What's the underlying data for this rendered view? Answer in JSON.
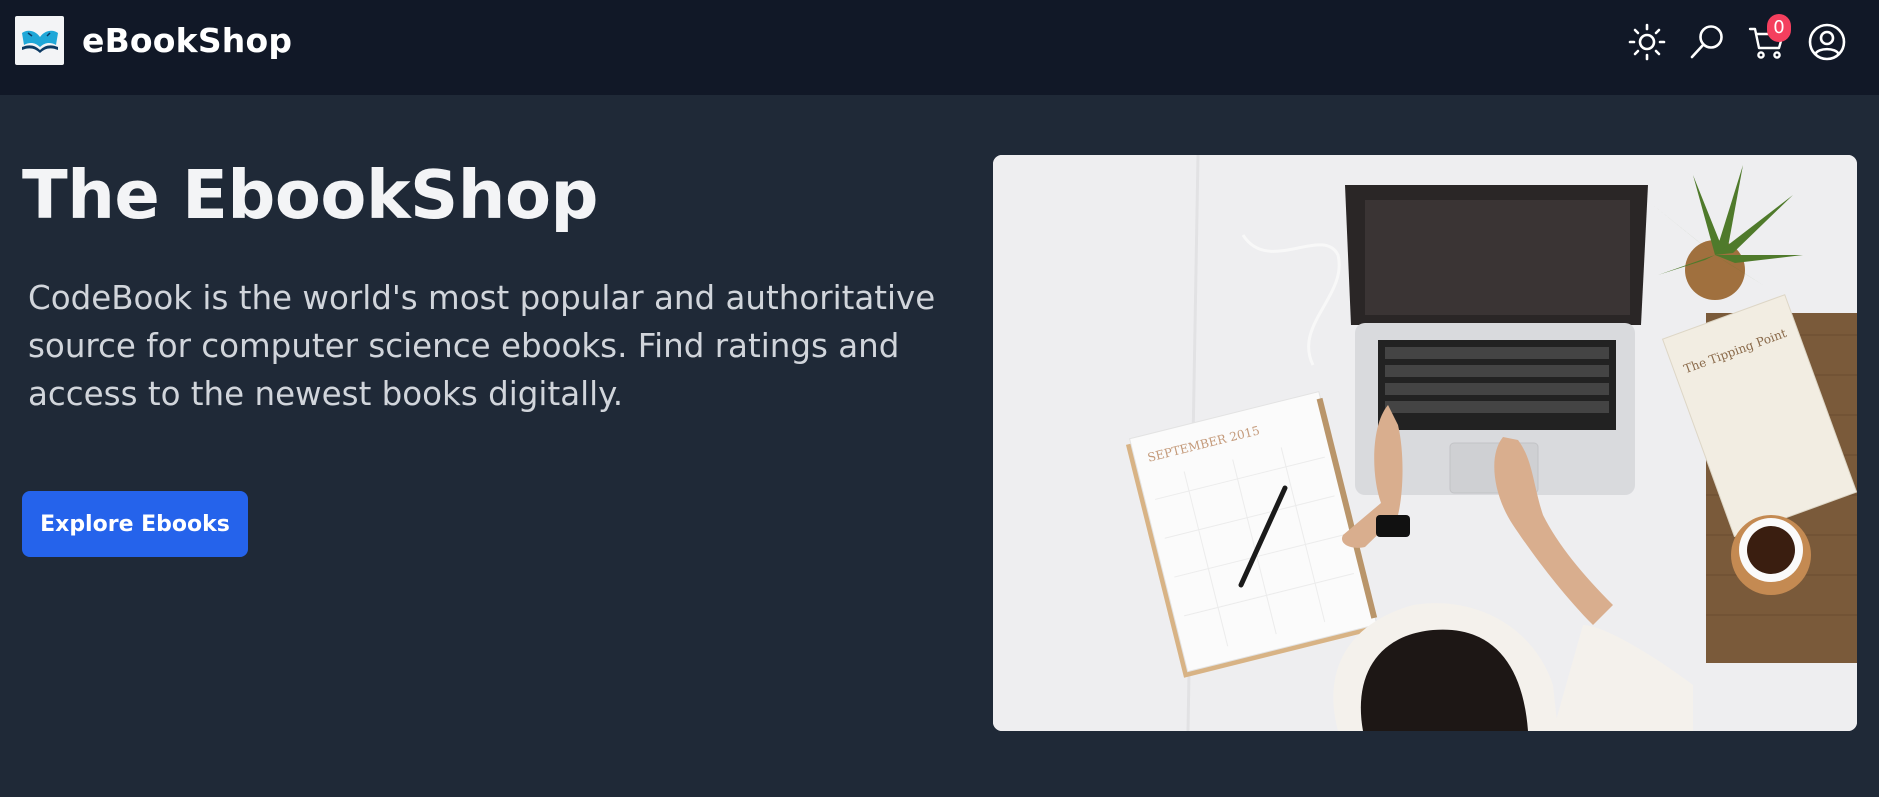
{
  "header": {
    "brand_name": "eBookShop",
    "icons": [
      "open-book-logo",
      "sun-icon",
      "search-icon",
      "cart-icon",
      "user-account-icon"
    ],
    "cart_count": "0"
  },
  "hero": {
    "title": "The EbookShop",
    "description": "CodeBook is the world's most popular and authoritative source for computer science ebooks. Find ratings and access to the newest books digitally.",
    "cta_label": "Explore Ebooks",
    "image_notebook_text": "SEPTEMBER 2015",
    "image_book_title": "The Tipping Point"
  },
  "colors": {
    "page_background": "#1f2937",
    "navbar_background": "#111827",
    "accent": "#2563eb",
    "badge": "#f43f5e"
  }
}
